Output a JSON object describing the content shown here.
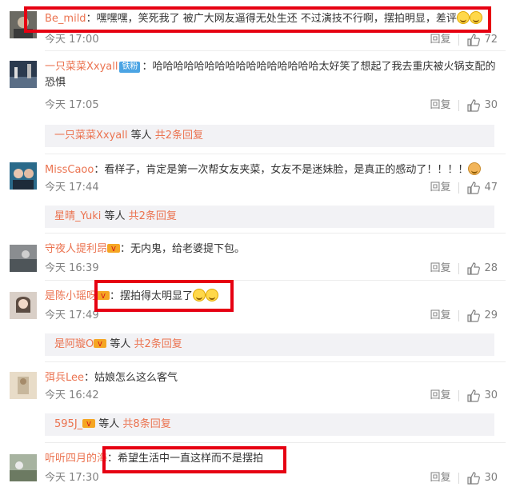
{
  "comments": [
    {
      "username": "Be_mild",
      "text": "：嘿嘿嘿，笑死我了 被广大网友逼得无处生还 不过演技不行啊，摆拍明显，差评",
      "time": "今天 17:00",
      "reply_label": "回复",
      "likes": "72"
    },
    {
      "username": "一只菜菜Xxyall",
      "badge": "铁粉",
      "text": "：哈哈哈哈哈哈哈哈哈哈哈哈哈哈哈哈太好笑了想起了我去重庆被火锅支配的恐惧",
      "time": "今天 17:05",
      "reply_label": "回复",
      "likes": "30",
      "sub": {
        "name": "一只菜菜Xxyall",
        "middle": " 等人 ",
        "more": "共2条回复"
      }
    },
    {
      "username": "MissCaoo",
      "text": "：看样子，肯定是第一次帮女友夹菜，女友不是迷妹脸，是真正的感动了！！！！",
      "time": "今天 17:44",
      "reply_label": "回复",
      "likes": "47",
      "sub": {
        "name": "星晴_Yuki",
        "middle": " 等人 ",
        "more": "共2条回复"
      }
    },
    {
      "username": "守夜人提利昂",
      "text": "：无内鬼，给老婆提下包。",
      "time": "今天 16:39",
      "reply_label": "回复",
      "likes": "28"
    },
    {
      "username": "是陈小瑶呀",
      "text": "：摆拍得太明显了",
      "time": "今天 17:49",
      "reply_label": "回复",
      "likes": "29",
      "sub": {
        "name": "是阿璇O",
        "middle": " 等人 ",
        "more": "共2条回复"
      }
    },
    {
      "username": "弭兵Lee",
      "text": "：姑娘怎么这么客气",
      "time": "今天 16:42",
      "reply_label": "回复",
      "likes": "30",
      "sub": {
        "name": "595J_",
        "middle": " 等人 ",
        "more": "共8条回复"
      }
    },
    {
      "username": "听听四月的海",
      "text": "：希望生活中一直这样而不是摆拍",
      "time": "今天 17:30",
      "reply_label": "回复",
      "likes": "30"
    }
  ],
  "colors": {
    "username": "#eb7350",
    "highlight": "#e60012",
    "meta": "#808080"
  }
}
